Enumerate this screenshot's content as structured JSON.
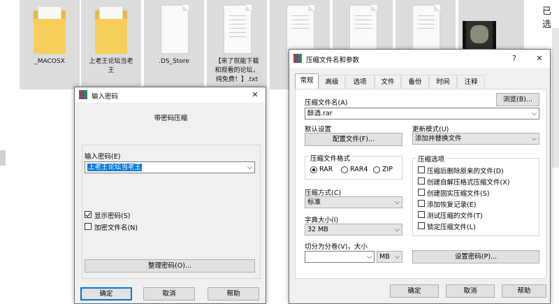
{
  "explorer": {
    "files": [
      {
        "name": "_MACOSX",
        "kind": "folder"
      },
      {
        "name": "上老王论坛当老\n王",
        "kind": "folder"
      },
      {
        "name": ".DS_Store",
        "kind": "doc"
      },
      {
        "name": "【来了就能下载\n和观看的论坛，\n纯免费！】.txt",
        "kind": "doc"
      },
      {
        "name": "【",
        "kind": "doc"
      },
      {
        "name": "",
        "kind": "doc"
      },
      {
        "name": "",
        "kind": "doc"
      },
      {
        "name": "",
        "kind": "video"
      }
    ],
    "side_text": "已选"
  },
  "password_dialog": {
    "title": "输入密码",
    "heading": "带密码压缩",
    "password_label": "输入密码(E)",
    "password_value": "上老王论坛当老王",
    "show_password": "显示密码(S)",
    "encrypt_names": "加密文件名(N)",
    "organize_button": "整理密码(O)...",
    "ok": "确定",
    "cancel": "取消",
    "help": "帮助"
  },
  "archive_dialog": {
    "title": "压缩文件名和参数",
    "help_glyph": "?",
    "close_glyph": "✕",
    "tabs": [
      "常规",
      "高级",
      "选项",
      "文件",
      "备份",
      "时间",
      "注释"
    ],
    "archive_name_label": "压缩文件名(A)",
    "browse_button": "浏览(B)...",
    "archive_name_value": "醉酒.rar",
    "default_settings_label": "默认设置",
    "profiles_button": "配置文件(F)...",
    "update_mode_label": "更新模式(U)",
    "update_mode_value": "添加并替换文件",
    "format_group": "压缩文件格式",
    "formats": [
      "RAR",
      "RAR4",
      "ZIP"
    ],
    "selected_format": "RAR",
    "method_label": "压缩方式(C)",
    "method_value": "标准",
    "dict_label": "字典大小(I)",
    "dict_value": "32 MB",
    "split_label": "切分为分卷(V)，大小",
    "split_unit": "MB",
    "options_group": "压缩选项",
    "options": [
      {
        "label": "压缩后删除原来的文件(D)",
        "checked": false
      },
      {
        "label": "创建自解压格式压缩文件(X)",
        "checked": false
      },
      {
        "label": "创建固实压缩文件(S)",
        "checked": false
      },
      {
        "label": "添加恢复记录(E)",
        "checked": false
      },
      {
        "label": "测试压缩的文件(T)",
        "checked": false
      },
      {
        "label": "锁定压缩文件(L)",
        "checked": false
      }
    ],
    "set_password_button": "设置密码(P)...",
    "ok": "确定",
    "cancel": "取消",
    "help": "帮助"
  },
  "colors": {
    "selection": "#0078d7",
    "folder": "#f6cf5b",
    "winrar_red": "#c2372f",
    "winrar_blue": "#3d5fb8",
    "winrar_green": "#3b8a3b"
  }
}
